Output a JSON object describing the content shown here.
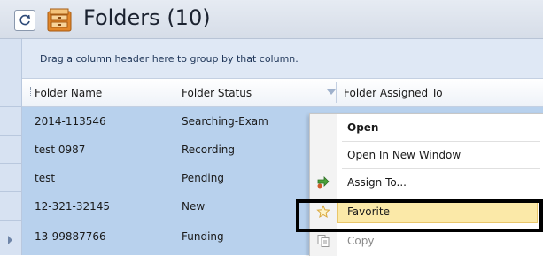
{
  "window": {
    "title": "Folders",
    "count": "(10)"
  },
  "grid": {
    "group_hint": "Drag a column header here to group by that column.",
    "columns": [
      "Folder Name",
      "Folder Status",
      "Folder Assigned To"
    ],
    "rows": [
      {
        "name": "2014-113546",
        "status": "Searching-Exam"
      },
      {
        "name": "test 0987",
        "status": "Recording"
      },
      {
        "name": "test",
        "status": "Pending"
      },
      {
        "name": "12-321-32145",
        "status": "New"
      },
      {
        "name": "13-99887766",
        "status": "Funding"
      }
    ]
  },
  "context_menu": {
    "items": [
      {
        "label": "Open",
        "icon": "none",
        "bold": true
      },
      {
        "label": "Open In New Window",
        "icon": "none"
      },
      {
        "label": "Assign To...",
        "icon": "assign-arrow-icon"
      },
      {
        "label": "Favorite",
        "icon": "star-icon",
        "highlighted": true
      },
      {
        "label": "Copy",
        "icon": "copy-icon",
        "disabled": true
      }
    ]
  },
  "colors": {
    "row_selected": "#b8d1ed",
    "highlight": "#fbe9a8",
    "annotation": "#000000"
  }
}
